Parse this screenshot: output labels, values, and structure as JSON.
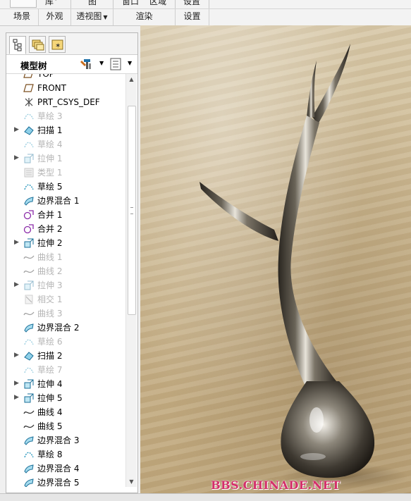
{
  "ribbon": {
    "top_labels": [
      "库",
      "图",
      "窗口",
      "区域",
      "设置"
    ],
    "groups": [
      {
        "label": "场景",
        "has_arrow": false
      },
      {
        "label": "外观",
        "has_arrow": false
      },
      {
        "label": "透视图",
        "has_arrow": true
      },
      {
        "label": "渲染",
        "has_arrow": false
      },
      {
        "label": "设置",
        "has_arrow": false
      }
    ]
  },
  "panel": {
    "tabs": [
      "model-tree-tab",
      "layer-tab",
      "favorites-tab"
    ],
    "title": "模型树",
    "tree": [
      {
        "label": "TOP",
        "icon": "datum-plane-icon",
        "expandable": false,
        "dim": false
      },
      {
        "label": "FRONT",
        "icon": "datum-plane-icon",
        "expandable": false,
        "dim": false
      },
      {
        "label": "PRT_CSYS_DEF",
        "icon": "csys-icon",
        "expandable": false,
        "dim": false
      },
      {
        "label": "草绘 3",
        "icon": "sketch-icon",
        "expandable": false,
        "dim": true
      },
      {
        "label": "扫描 1",
        "icon": "sweep-icon",
        "expandable": true,
        "dim": false
      },
      {
        "label": "草绘 4",
        "icon": "sketch-icon",
        "expandable": false,
        "dim": true
      },
      {
        "label": "拉伸 1",
        "icon": "extrude-icon",
        "expandable": true,
        "dim": true
      },
      {
        "label": "类型 1",
        "icon": "type-icon",
        "expandable": false,
        "dim": true
      },
      {
        "label": "草绘 5",
        "icon": "sketch-icon",
        "expandable": false,
        "dim": false
      },
      {
        "label": "边界混合 1",
        "icon": "boundary-blend-icon",
        "expandable": false,
        "dim": false
      },
      {
        "label": "合并 1",
        "icon": "merge-icon",
        "expandable": false,
        "dim": false
      },
      {
        "label": "合并 2",
        "icon": "merge-icon",
        "expandable": false,
        "dim": false
      },
      {
        "label": "拉伸 2",
        "icon": "extrude-icon",
        "expandable": true,
        "dim": false
      },
      {
        "label": "曲线 1",
        "icon": "curve-icon",
        "expandable": false,
        "dim": true
      },
      {
        "label": "曲线 2",
        "icon": "curve-icon",
        "expandable": false,
        "dim": true
      },
      {
        "label": "拉伸 3",
        "icon": "extrude-icon",
        "expandable": true,
        "dim": true
      },
      {
        "label": "相交 1",
        "icon": "intersect-icon",
        "expandable": false,
        "dim": true
      },
      {
        "label": "曲线 3",
        "icon": "curve-icon",
        "expandable": false,
        "dim": true
      },
      {
        "label": "边界混合 2",
        "icon": "boundary-blend-icon",
        "expandable": false,
        "dim": false
      },
      {
        "label": "草绘 6",
        "icon": "sketch-icon",
        "expandable": false,
        "dim": true
      },
      {
        "label": "扫描 2",
        "icon": "sweep-icon",
        "expandable": true,
        "dim": false
      },
      {
        "label": "草绘 7",
        "icon": "sketch-icon",
        "expandable": false,
        "dim": true
      },
      {
        "label": "拉伸 4",
        "icon": "extrude-icon",
        "expandable": true,
        "dim": false
      },
      {
        "label": "拉伸 5",
        "icon": "extrude-icon",
        "expandable": true,
        "dim": false
      },
      {
        "label": "曲线 4",
        "icon": "curve-icon",
        "expandable": false,
        "dim": false
      },
      {
        "label": "曲线 5",
        "icon": "curve-icon",
        "expandable": false,
        "dim": false
      },
      {
        "label": "边界混合 3",
        "icon": "boundary-blend-icon",
        "expandable": false,
        "dim": false
      },
      {
        "label": "草绘 8",
        "icon": "sketch-icon",
        "expandable": false,
        "dim": false
      },
      {
        "label": "边界混合 4",
        "icon": "boundary-blend-icon",
        "expandable": false,
        "dim": false
      },
      {
        "label": "边界混合 5",
        "icon": "boundary-blend-icon",
        "expandable": false,
        "dim": false
      }
    ]
  },
  "viewport": {
    "watermark": "BBS.CHINADE.NET"
  },
  "colors": {
    "watermark": "#d42f6a",
    "feature_icon": "#1a8fb8",
    "merge_icon": "#8a2aa8",
    "dim_text": "#b5b5b5"
  }
}
